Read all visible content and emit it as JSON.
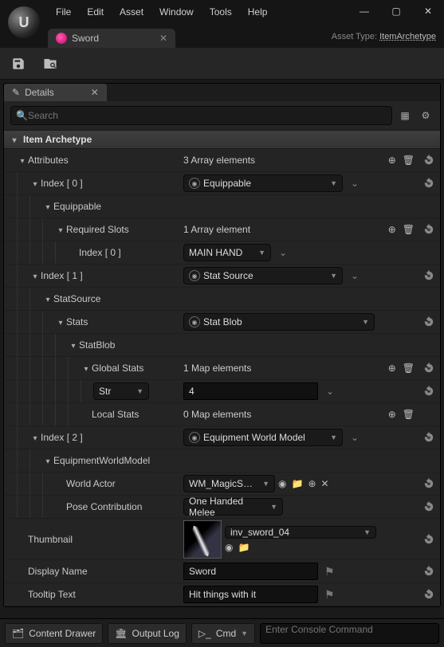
{
  "menu": {
    "file": "File",
    "edit": "Edit",
    "asset": "Asset",
    "window": "Window",
    "tools": "Tools",
    "help": "Help"
  },
  "tab": {
    "title": "Sword"
  },
  "asset_type": {
    "label": "Asset Type:",
    "value": "ItemArchetype"
  },
  "details": {
    "title": "Details"
  },
  "search": {
    "placeholder": "Search"
  },
  "categories": {
    "item_archetype": "Item Archetype",
    "attributes": "Attributes"
  },
  "attr": {
    "count": "3 Array elements",
    "idx0": {
      "label": "Index [ 0 ]",
      "class": "Equippable",
      "name": "Equippable",
      "required_slots": {
        "label": "Required Slots",
        "count": "1 Array element",
        "idx": {
          "label": "Index [ 0 ]",
          "value": "MAIN HAND"
        }
      }
    },
    "idx1": {
      "label": "Index [ 1 ]",
      "class": "Stat Source",
      "name": "StatSource",
      "stats": {
        "label": "Stats",
        "class": "Stat Blob",
        "blob": {
          "label": "StatBlob",
          "global": {
            "label": "Global Stats",
            "count": "1 Map elements",
            "key": "Str",
            "value": "4"
          },
          "local": {
            "label": "Local Stats",
            "count": "0 Map elements"
          }
        }
      }
    },
    "idx2": {
      "label": "Index [ 2 ]",
      "class": "Equipment World Model",
      "name": "EquipmentWorldModel",
      "world_actor": {
        "label": "World Actor",
        "value": "WM_MagicSword"
      },
      "pose": {
        "label": "Pose Contribution",
        "value": "One Handed Melee"
      }
    }
  },
  "thumbnail": {
    "label": "Thumbnail",
    "asset": "inv_sword_04"
  },
  "display_name": {
    "label": "Display Name",
    "value": "Sword"
  },
  "tooltip": {
    "label": "Tooltip Text",
    "value": "Hit things with it"
  },
  "status": {
    "content_drawer": "Content Drawer",
    "output_log": "Output Log",
    "cmd": "Cmd",
    "cmd_placeholder": "Enter Console Command"
  }
}
